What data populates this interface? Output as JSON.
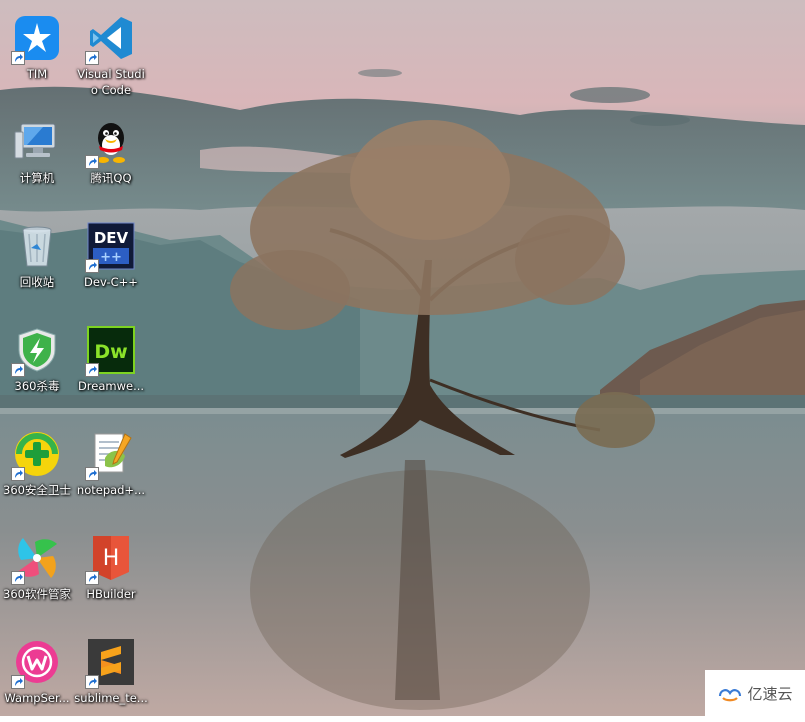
{
  "desktop": {
    "icons": [
      {
        "label": "TIM",
        "icon": "tim-icon",
        "shortcut": true
      },
      {
        "label": "Visual Studio Code",
        "icon": "vscode-icon",
        "shortcut": true
      },
      {
        "label": "计算机",
        "icon": "computer-icon",
        "shortcut": false
      },
      {
        "label": "腾讯QQ",
        "icon": "qq-icon",
        "shortcut": true
      },
      {
        "label": "回收站",
        "icon": "recycle-bin-icon",
        "shortcut": false
      },
      {
        "label": "Dev-C++",
        "icon": "dev-cpp-icon",
        "shortcut": true
      },
      {
        "label": "360杀毒",
        "icon": "360-antivirus-icon",
        "shortcut": true
      },
      {
        "label": "Dreamwe...",
        "icon": "dreamweaver-icon",
        "shortcut": true
      },
      {
        "label": "360安全卫士",
        "icon": "360-security-icon",
        "shortcut": true
      },
      {
        "label": "notepad+...",
        "icon": "notepad-plus-plus-icon",
        "shortcut": true
      },
      {
        "label": "360软件管家",
        "icon": "360-software-manager-icon",
        "shortcut": true
      },
      {
        "label": "HBuilder",
        "icon": "hbuilder-icon",
        "shortcut": true
      },
      {
        "label": "WampSer...",
        "icon": "wampserver-icon",
        "shortcut": true
      },
      {
        "label": "sublime_te...",
        "icon": "sublime-text-icon",
        "shortcut": true
      }
    ]
  },
  "watermark": {
    "text": "亿速云",
    "icon": "yisu-cloud-logo-icon"
  }
}
